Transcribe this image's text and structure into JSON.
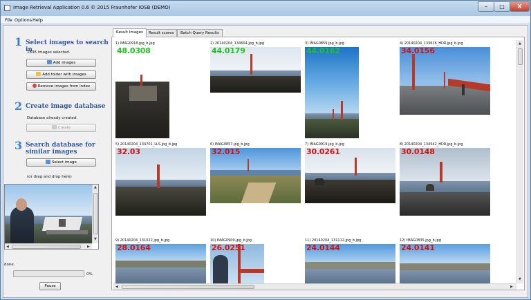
{
  "window": {
    "title": "Image Retrieval Application 0.6 © 2015 Fraunhofer IOSB (DEMO)",
    "controls": {
      "minimize": "–",
      "maximize": "□",
      "close": "X"
    }
  },
  "menu": [
    "File",
    "Options",
    "Help"
  ],
  "steps": [
    {
      "number": "1",
      "title": "Select images to search in"
    },
    {
      "number": "2",
      "title": "Create image database"
    },
    {
      "number": "3",
      "title": "Search database for similar images"
    }
  ],
  "step1": {
    "status": "1836 images selected.",
    "add_images": "Add images",
    "add_folder": "Add folder with images",
    "remove_images": "Remove images from index"
  },
  "step2": {
    "status": "Database already created.",
    "create": "Create"
  },
  "step3": {
    "select_image": "Select image",
    "drag_hint": "(or drag and drop here)"
  },
  "progress": {
    "status": "done.",
    "percent_label": "0%",
    "value": 0,
    "pause": "Pause"
  },
  "tabs": [
    "Result Images",
    "Result scores",
    "Batch Query Results"
  ],
  "results": [
    {
      "label": "1) IMAG0918.jpg_b.jpg",
      "score": "48.0308",
      "color": "#22c222"
    },
    {
      "label": "2) 20140204_134604.jpg_b.jpg",
      "score": "44.0179",
      "color": "#22c222"
    },
    {
      "label": "3) IMAG0859.jpg_b.jpg",
      "score": "44.0162",
      "color": "#22c222"
    },
    {
      "label": "4) 20140204_133616_HDR.jpg_b.jpg",
      "score": "34.0156",
      "color": "#d01414"
    },
    {
      "label": "5) 20140204_134701_LLS.jpg_b.jpg",
      "score": "32.03",
      "color": "#d01414"
    },
    {
      "label": "6) IMAG0857.jpg_b.jpg",
      "score": "32.015",
      "color": "#d01414"
    },
    {
      "label": "7) IMAG0919.jpg_b.jpg",
      "score": "30.0261",
      "color": "#d01414"
    },
    {
      "label": "8) 20140204_134542_HDR.jpg_b.jpg",
      "score": "30.0148",
      "color": "#d01414"
    },
    {
      "label": "9) 20140204_131022.jpg_b.jpg",
      "score": "28.0164",
      "color": "#d01414"
    },
    {
      "label": "10) IMAG0909.jpg_b.jpg",
      "score": "26.0251",
      "color": "#d01414"
    },
    {
      "label": "11) 20140204_131112.jpg_b.jpg",
      "score": "24.0144",
      "color": "#d01414"
    },
    {
      "label": "12) IMAG0835.jpg_b.jpg",
      "score": "24.0141",
      "color": "#d01414"
    }
  ],
  "colors": {
    "step_number": "#3d7fd0",
    "step_title": "#2f55a4",
    "score_high": "#22c222",
    "score_low": "#d01414"
  }
}
